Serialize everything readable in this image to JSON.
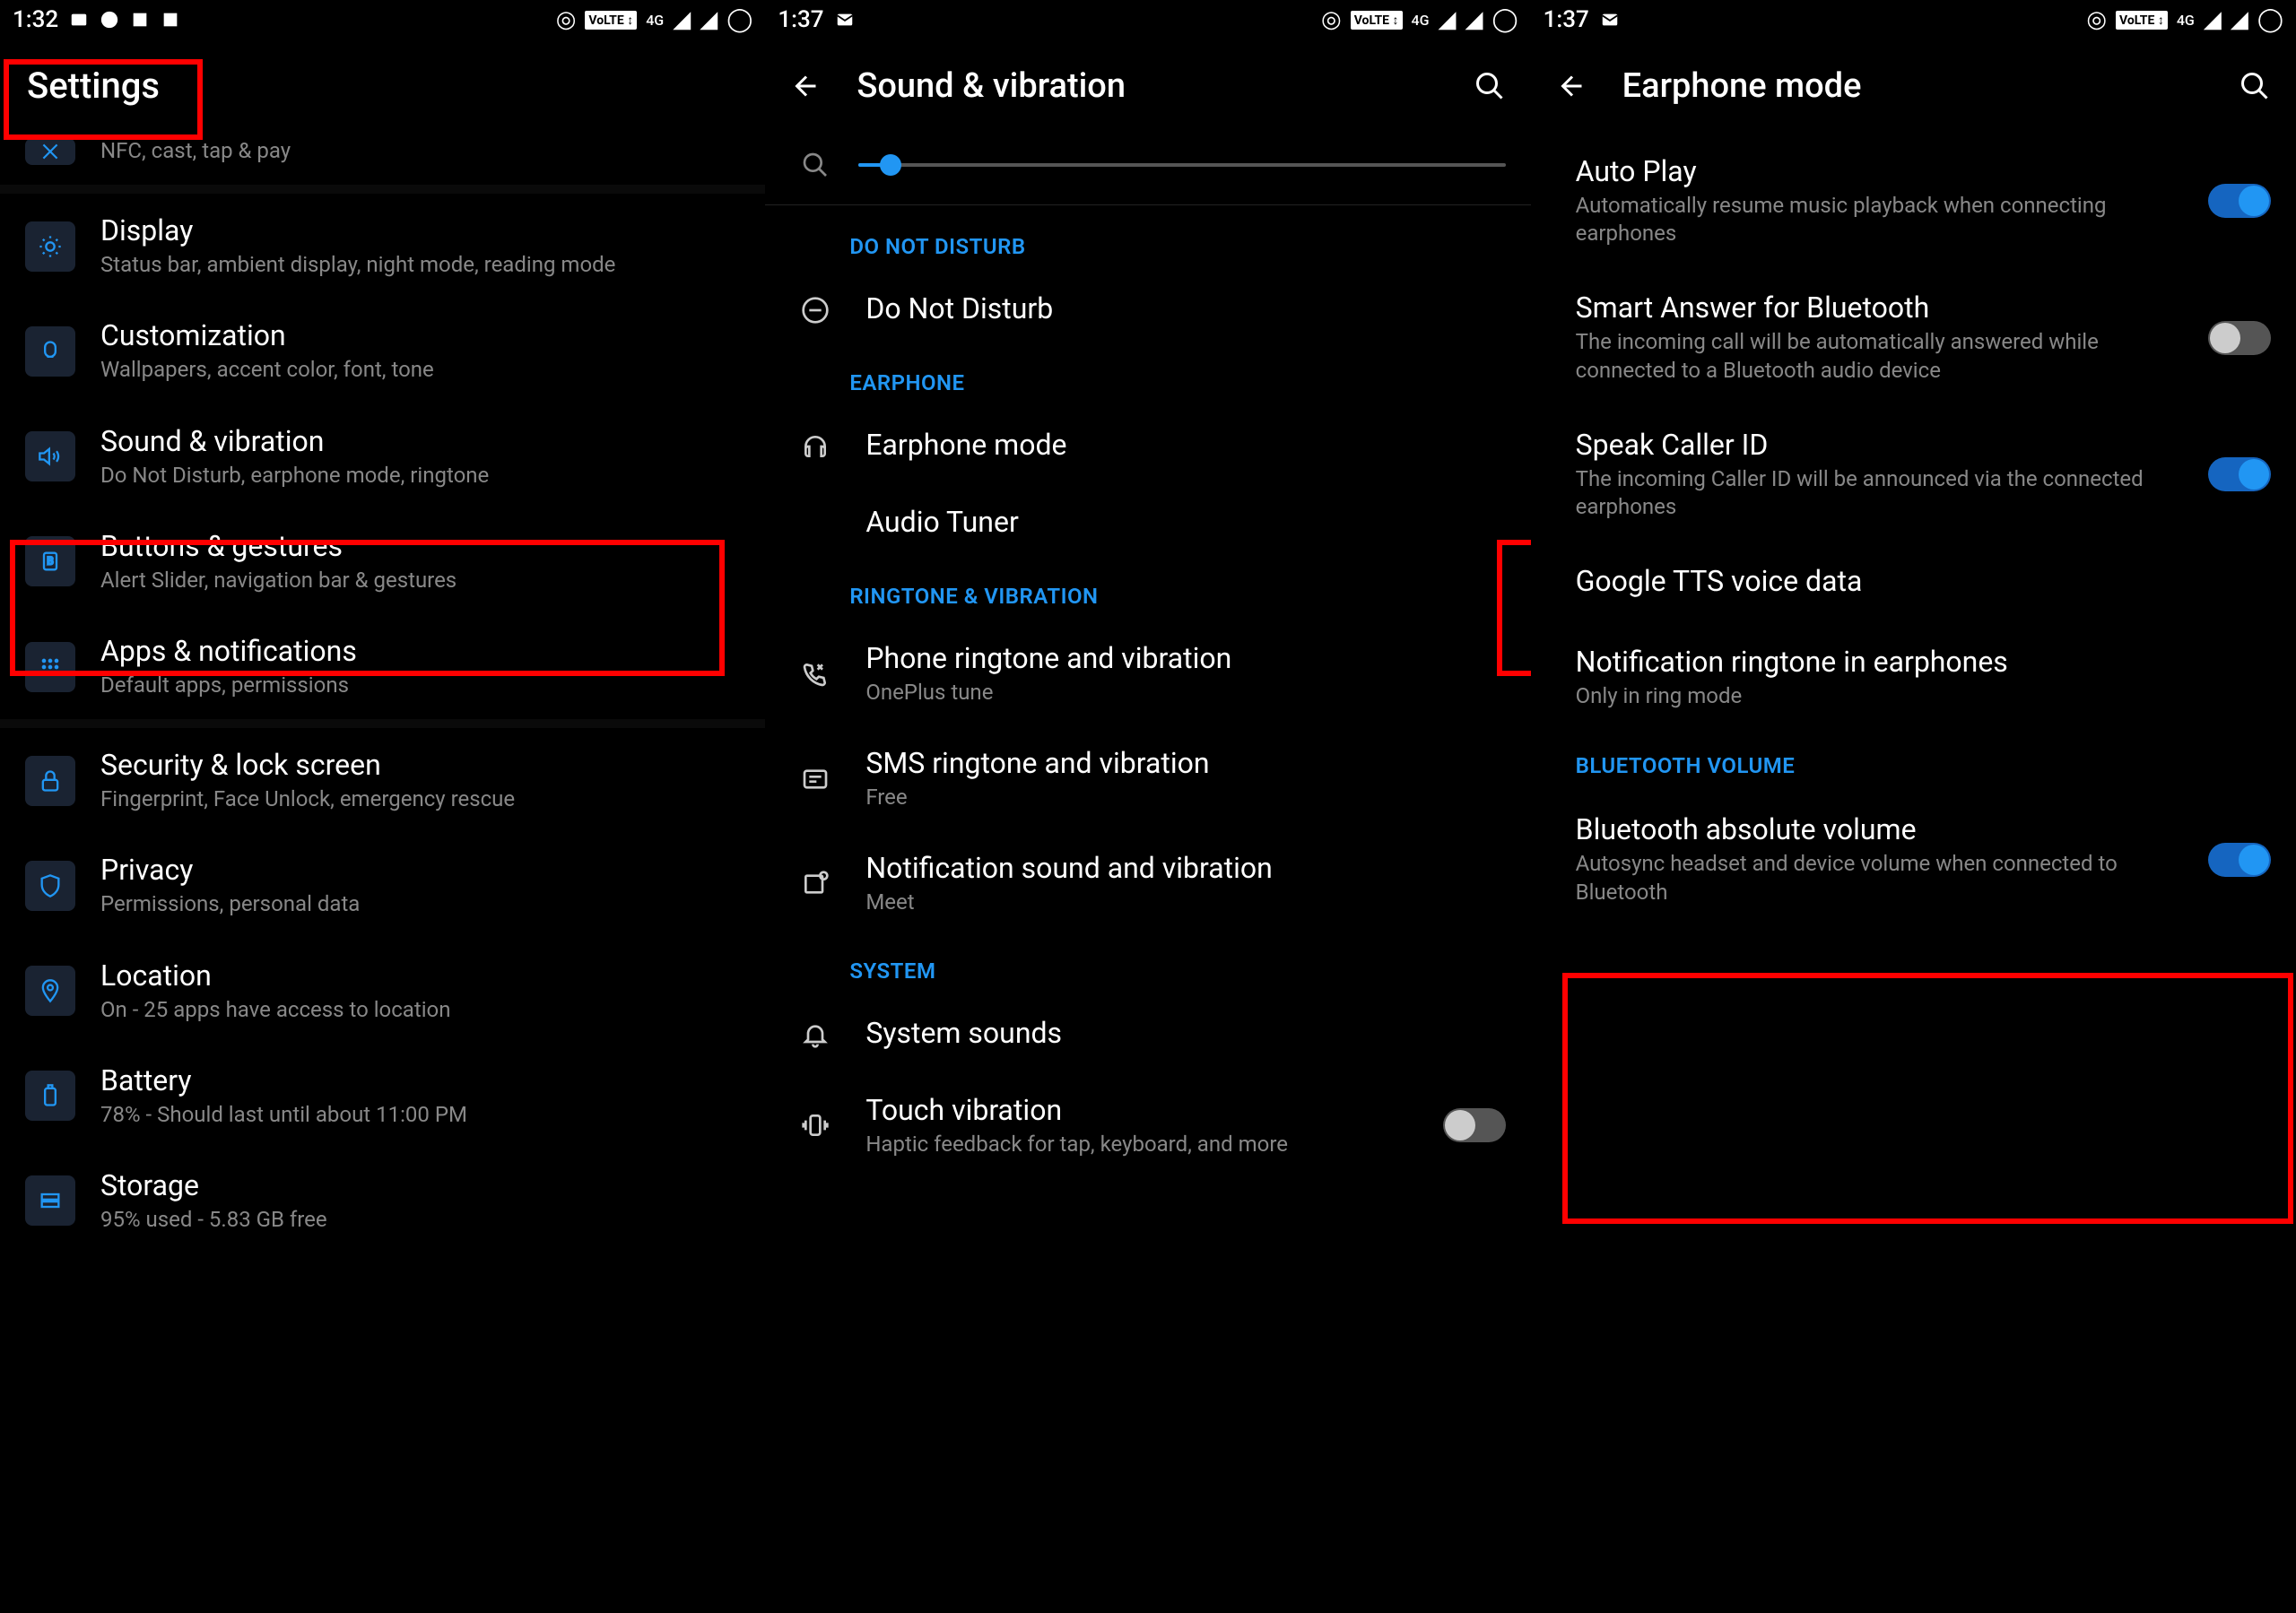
{
  "panel1": {
    "status": {
      "time": "1:32"
    },
    "title": "Settings",
    "nfc_row": {
      "subtitle": "NFC, cast, tap & pay"
    },
    "items": [
      {
        "title": "Display",
        "subtitle": "Status bar, ambient display, night mode, reading mode"
      },
      {
        "title": "Customization",
        "subtitle": "Wallpapers, accent color, font, tone"
      },
      {
        "title": "Sound & vibration",
        "subtitle": "Do Not Disturb, earphone mode, ringtone"
      },
      {
        "title": "Buttons & gestures",
        "subtitle": "Alert Slider, navigation bar & gestures"
      },
      {
        "title": "Apps & notifications",
        "subtitle": "Default apps, permissions"
      }
    ],
    "items2": [
      {
        "title": "Security & lock screen",
        "subtitle": "Fingerprint, Face Unlock, emergency rescue"
      },
      {
        "title": "Privacy",
        "subtitle": "Permissions, personal data"
      },
      {
        "title": "Location",
        "subtitle": "On - 25 apps have access to location"
      },
      {
        "title": "Battery",
        "subtitle": "78% - Should last until about 11:00 PM"
      },
      {
        "title": "Storage",
        "subtitle": "95% used - 5.83 GB free"
      }
    ]
  },
  "panel2": {
    "status": {
      "time": "1:37"
    },
    "title": "Sound & vibration",
    "sections": {
      "dnd": "DO NOT DISTURB",
      "earphone": "EARPHONE",
      "ringtone": "RINGTONE & VIBRATION",
      "system": "SYSTEM"
    },
    "items": {
      "dnd": "Do Not Disturb",
      "earphone_mode": "Earphone mode",
      "audio_tuner": "Audio Tuner",
      "phone_ringtone": {
        "title": "Phone ringtone and vibration",
        "subtitle": "OnePlus tune"
      },
      "sms_ringtone": {
        "title": "SMS ringtone and vibration",
        "subtitle": "Free"
      },
      "notif_sound": {
        "title": "Notification sound and vibration",
        "subtitle": "Meet"
      },
      "system_sounds": "System sounds",
      "touch_vibration": {
        "title": "Touch vibration",
        "subtitle": "Haptic feedback for tap, keyboard, and more"
      }
    }
  },
  "panel3": {
    "status": {
      "time": "1:37"
    },
    "title": "Earphone mode",
    "items": [
      {
        "title": "Auto Play",
        "subtitle": "Automatically resume music playback when connecting earphones",
        "on": true
      },
      {
        "title": "Smart Answer for Bluetooth",
        "subtitle": "The incoming call will be automatically answered while connected to a Bluetooth audio device",
        "on": false
      },
      {
        "title": "Speak Caller ID",
        "subtitle": "The incoming Caller ID will be announced via the connected earphones",
        "on": true
      },
      {
        "title": "Google TTS voice data"
      },
      {
        "title": "Notification ringtone in earphones",
        "subtitle": "Only in ring mode"
      }
    ],
    "bt_section": "BLUETOOTH VOLUME",
    "bt_item": {
      "title": "Bluetooth absolute volume",
      "subtitle": "Autosync headset and device volume when connected to Bluetooth",
      "on": true
    }
  }
}
